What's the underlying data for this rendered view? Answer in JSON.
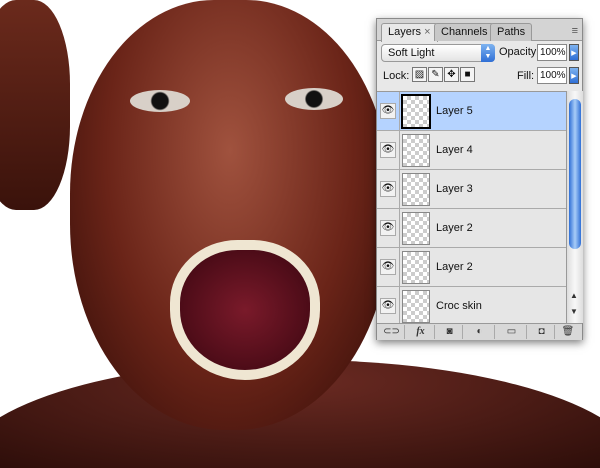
{
  "panel": {
    "tabs": [
      {
        "label": "Layers",
        "active": true,
        "close": "×"
      },
      {
        "label": "Channels"
      },
      {
        "label": "Paths"
      }
    ],
    "window_controls": {
      "minimize": "–",
      "close": "×",
      "menu": "≡"
    },
    "blend_mode": "Soft Light",
    "opacity_label": "Opacity:",
    "opacity_value": "100%",
    "lock_label": "Lock:",
    "fill_label": "Fill:",
    "fill_value": "100%",
    "lock_icons": [
      "lock-transparent-icon",
      "lock-image-icon",
      "lock-position-icon",
      "lock-all-icon"
    ],
    "layers": [
      {
        "name": "Layer 5",
        "visible": true,
        "selected": true
      },
      {
        "name": "Layer 4",
        "visible": true
      },
      {
        "name": "Layer 3",
        "visible": true
      },
      {
        "name": "Layer 2",
        "visible": true
      },
      {
        "name": "Layer 2",
        "visible": true
      },
      {
        "name": "Croc skin",
        "visible": true
      }
    ],
    "bottom_buttons": [
      "link-icon",
      "fx-icon",
      "mask-icon",
      "adjustment-icon",
      "folder-icon",
      "new-layer-icon",
      "trash-icon"
    ],
    "fx_label": "fx",
    "accent": "#b5d3ff"
  }
}
